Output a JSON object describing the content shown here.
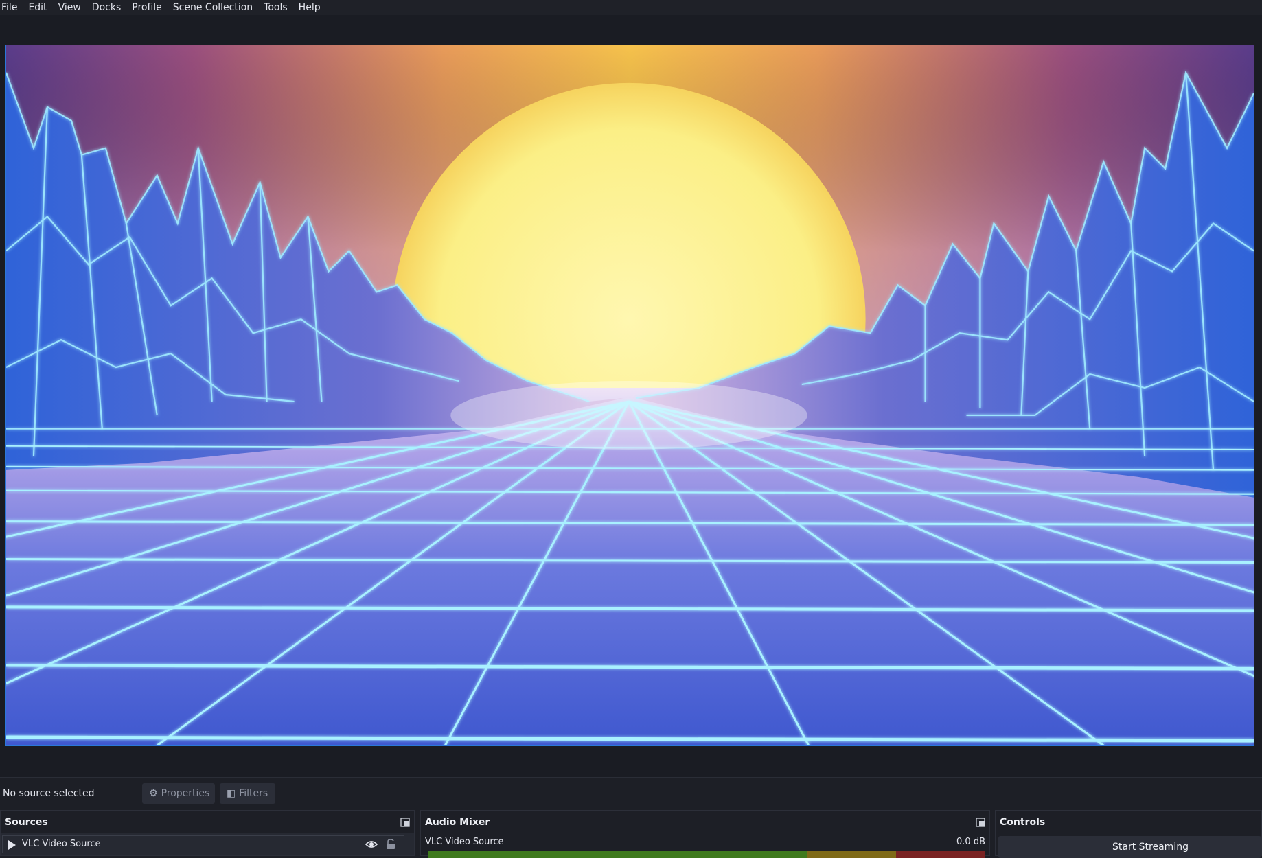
{
  "menubar": {
    "items": [
      "File",
      "Edit",
      "View",
      "Docks",
      "Profile",
      "Scene Collection",
      "Tools",
      "Help"
    ]
  },
  "preview": {
    "scene": "synthwave-neon-grid-mountains-sunset"
  },
  "context_bar": {
    "status_text": "No source selected",
    "properties_label": "Properties",
    "properties_icon": "gear-icon",
    "filters_label": "Filters",
    "filters_icon": "filter-icon"
  },
  "docks": {
    "sources": {
      "title": "Sources",
      "items": [
        {
          "label": "VLC Video Source",
          "icon": "play-icon",
          "visible": true,
          "locked": false
        }
      ]
    },
    "audio_mixer": {
      "title": "Audio Mixer",
      "channels": [
        {
          "name": "VLC Video Source",
          "level": "0.0 dB"
        }
      ]
    },
    "controls": {
      "title": "Controls",
      "start_streaming_label": "Start Streaming"
    }
  },
  "colors": {
    "accent_border": "#2b78d8",
    "background": "#1d1f26",
    "panel": "#262932"
  }
}
